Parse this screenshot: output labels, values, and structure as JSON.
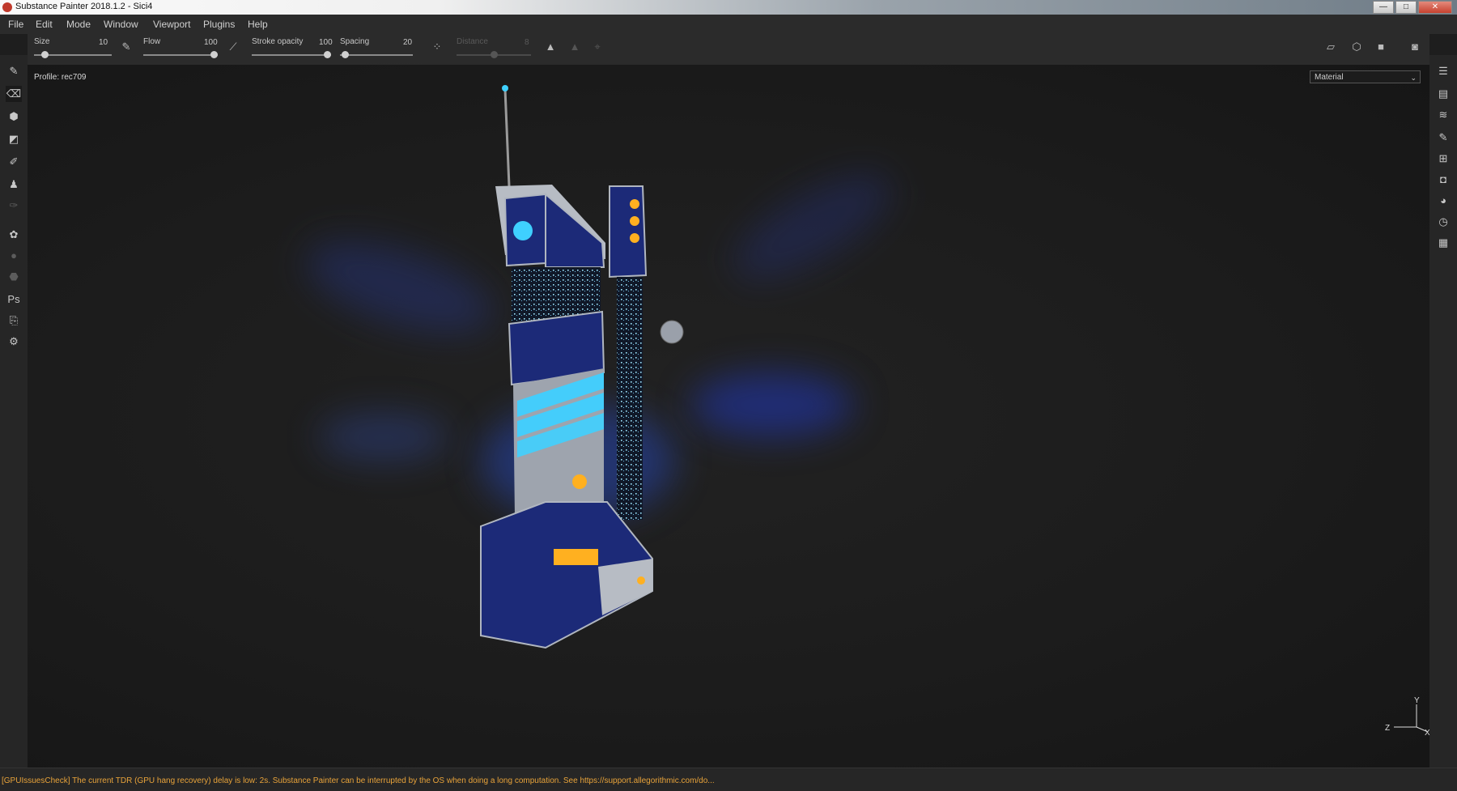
{
  "window": {
    "title": "Substance Painter 2018.1.2 - Sici4",
    "buttons": {
      "minimize": "—",
      "maximize": "□",
      "close": "✕"
    }
  },
  "menu": [
    "File",
    "Edit",
    "Mode",
    "Window",
    "Viewport",
    "Plugins",
    "Help"
  ],
  "toolbar": {
    "size": {
      "label": "Size",
      "value": "10",
      "fraction": 0.1
    },
    "flow": {
      "label": "Flow",
      "value": "100",
      "fraction": 1.0
    },
    "stroke_opacity": {
      "label": "Stroke opacity",
      "value": "100",
      "fraction": 1.0
    },
    "spacing": {
      "label": "Spacing",
      "value": "20",
      "fraction": 0.02
    },
    "distance": {
      "label": "Distance",
      "value": "8",
      "fraction": 0.5,
      "disabled": true
    }
  },
  "viewport": {
    "profile": "Profile: rec709",
    "channel_select": "Material",
    "axes": {
      "x": "X",
      "y": "Y",
      "z": "Z"
    }
  },
  "status": {
    "message": "[GPUIssuesCheck] The current TDR (GPU hang recovery) delay is low: 2s. Substance Painter can be interrupted by the OS when doing a long computation. See https://support.allegorithmic.com/do..."
  },
  "colors": {
    "accent_cyan": "#3fd0ff",
    "hull_blue": "#1c2a78",
    "glow_orange": "#ffb020",
    "status_text": "#e8a33a"
  }
}
